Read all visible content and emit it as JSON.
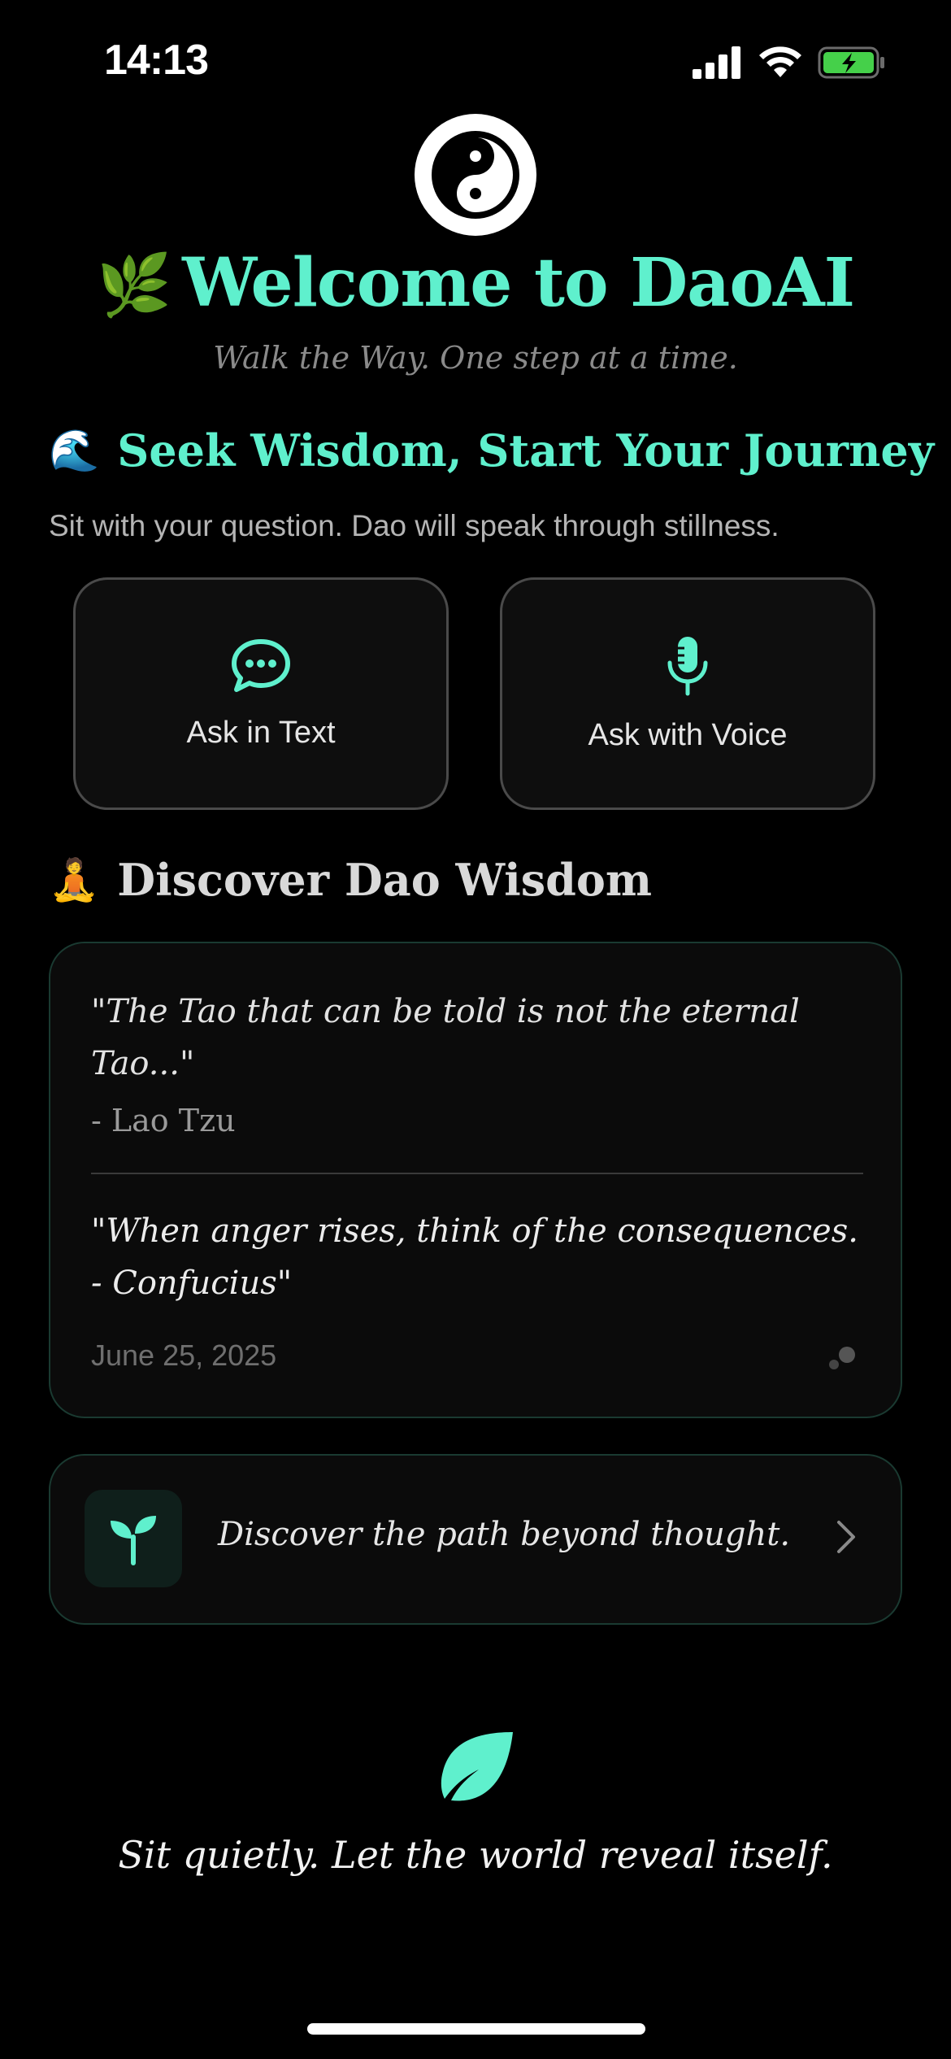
{
  "status_bar": {
    "time": "14:13",
    "icons": [
      "cellular-signal-icon",
      "wifi-icon",
      "battery-charging-icon"
    ]
  },
  "header": {
    "logo_icon": "yin-yang-icon",
    "title_emoji": "🌿",
    "title": "Welcome to DaoAI",
    "tagline": "Walk the Way. One step at a time."
  },
  "seek": {
    "emoji": "🌊",
    "title": "Seek Wisdom, Start Your Journey",
    "subtitle": "Sit with your question. Dao will speak through stillness."
  },
  "ask_buttons": {
    "text": {
      "label": "Ask in Text",
      "icon": "chat-bubble-icon"
    },
    "voice": {
      "label": "Ask with Voice",
      "icon": "microphone-icon"
    }
  },
  "discover": {
    "emoji": "🧘",
    "title": "Discover Dao Wisdom"
  },
  "wisdom_card": {
    "quote1": "\"The Tao that can be told is not the eternal Tao...\"",
    "author1": "- Lao Tzu",
    "quote2": "\"When anger rises, think of the consequences. - Confucius\"",
    "date": "June 25, 2025",
    "corner_icon": "dots-icon"
  },
  "path_card": {
    "icon": "sprout-icon",
    "text": "Discover the path beyond thought.",
    "chevron": "chevron-right-icon"
  },
  "footer": {
    "icon": "leaf-icon",
    "quote": "Sit quietly. Let the world reveal itself."
  },
  "colors": {
    "accent": "#5ff0cd",
    "background": "#000000",
    "card_border": "#1a3a31"
  }
}
